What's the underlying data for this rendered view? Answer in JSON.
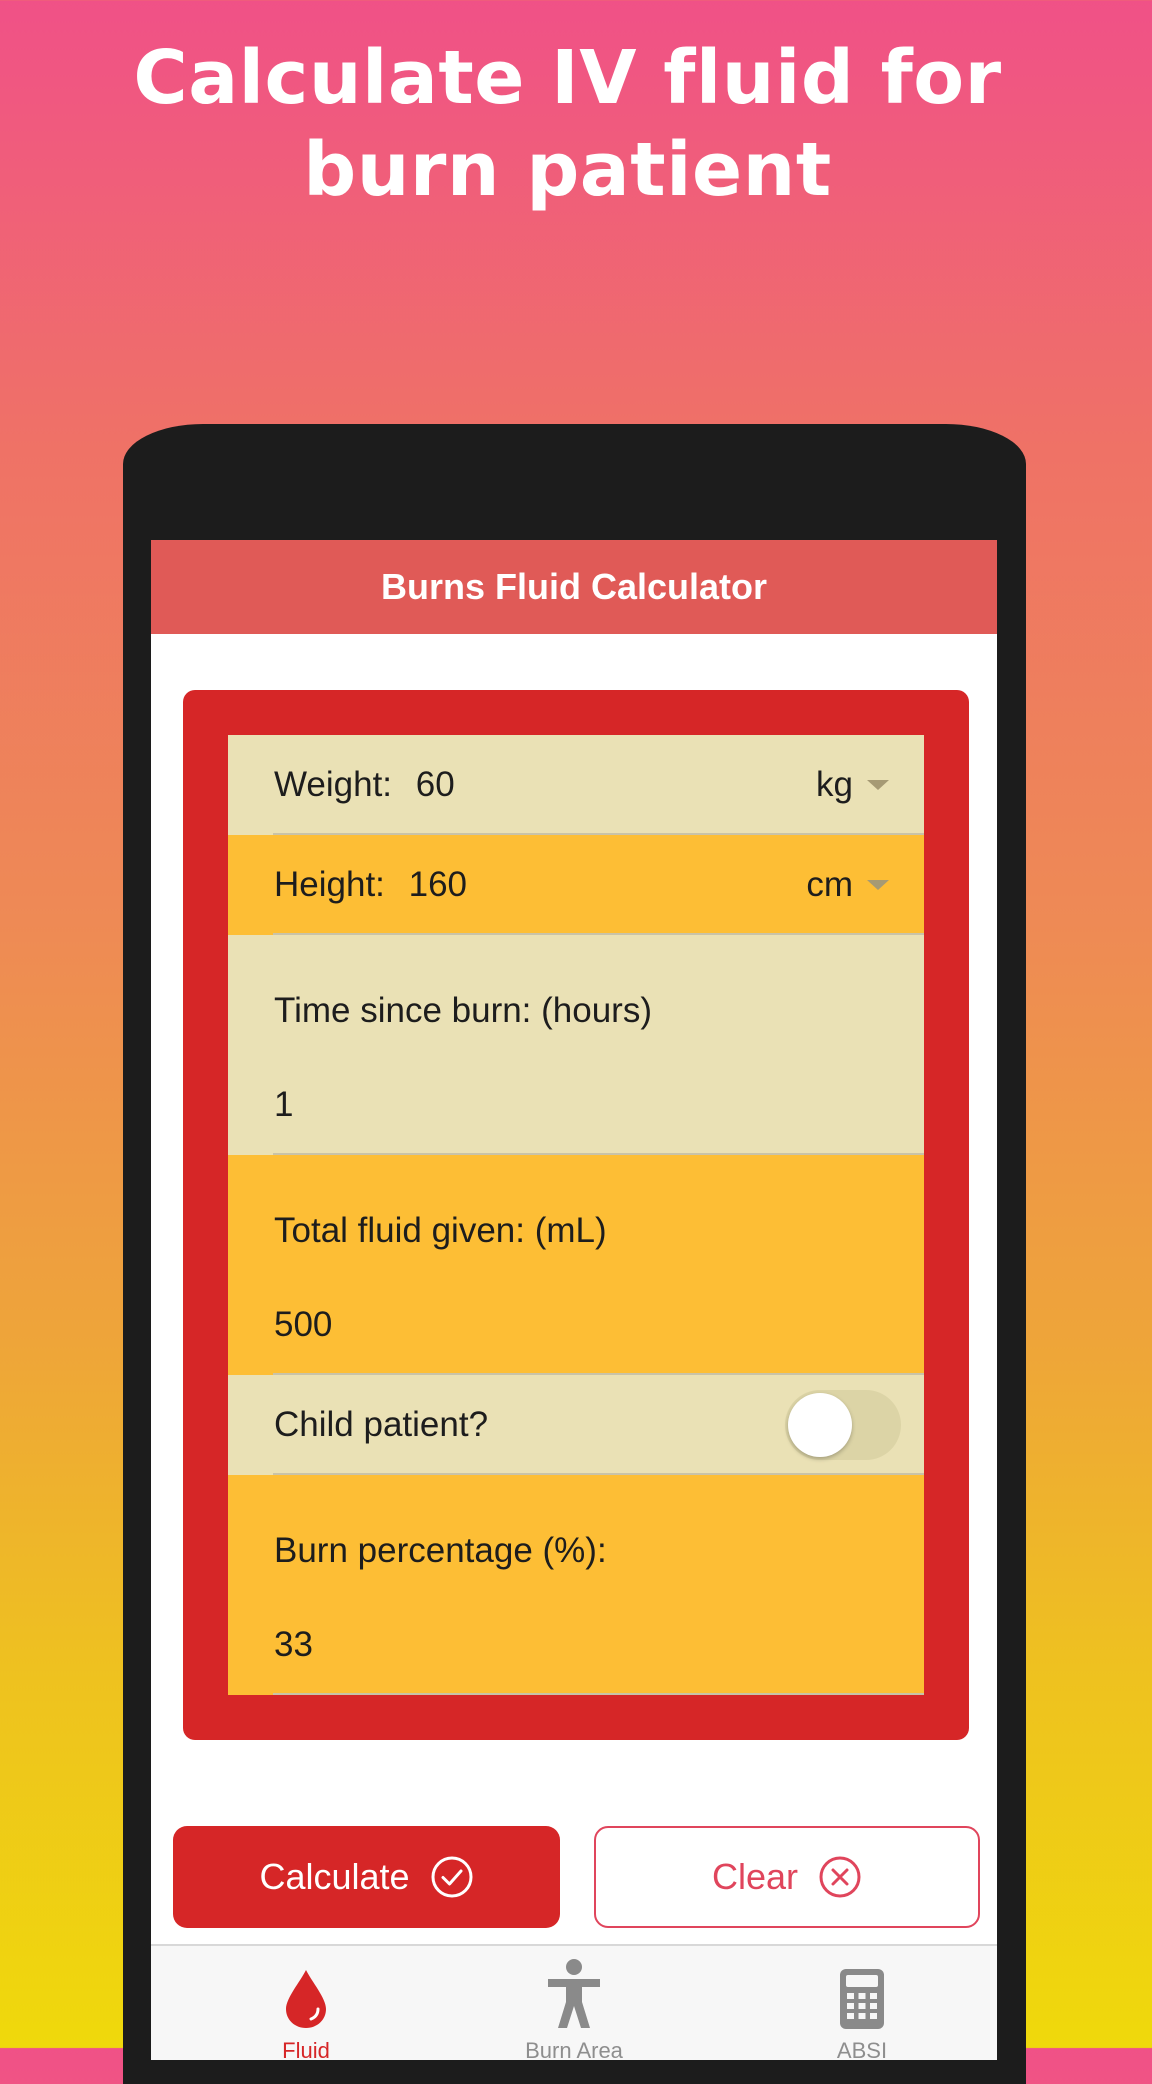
{
  "promo": {
    "line1": "Calculate IV fluid for",
    "line2": "burn patient"
  },
  "app": {
    "title": "Burns Fluid Calculator"
  },
  "form": {
    "weight": {
      "label": "Weight: ",
      "value": "60",
      "unit": "kg"
    },
    "height": {
      "label": "Height: ",
      "value": "160",
      "unit": "cm"
    },
    "time_since_burn": {
      "label": "Time since burn: (hours)",
      "value": "1"
    },
    "total_fluid": {
      "label": "Total fluid given: (mL)",
      "value": "500"
    },
    "child_patient": {
      "label": "Child patient?",
      "checked": false
    },
    "burn_percentage": {
      "label": "Burn percentage (%):",
      "value": "33"
    }
  },
  "buttons": {
    "calculate": "Calculate",
    "clear": "Clear"
  },
  "tabs": [
    {
      "label": "Fluid",
      "icon": "drop-icon",
      "active": true
    },
    {
      "label": "Burn Area",
      "icon": "person-icon",
      "active": false
    },
    {
      "label": "ABSI",
      "icon": "calculator-icon",
      "active": false
    }
  ],
  "colors": {
    "nav_bar": "#e05a57",
    "card_red": "#d62627",
    "row_beige": "#eae1b5",
    "row_amber": "#fdbe35",
    "clear_accent": "#e0455c"
  }
}
